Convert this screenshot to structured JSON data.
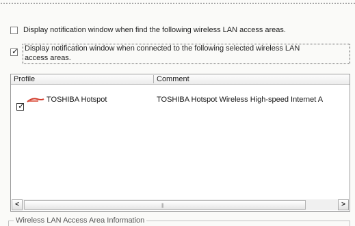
{
  "options": {
    "find_areas_label": "Display notification window when find the following wireless LAN access areas.",
    "find_areas_checked": false,
    "connected_areas_label_line1": "Display notification window when connected to the following selected wireless LAN",
    "connected_areas_label_line2": "access areas.",
    "connected_areas_checked": true
  },
  "profile_list": {
    "columns": [
      "Profile",
      "Comment"
    ],
    "rows": [
      {
        "checked": true,
        "profile": "TOSHIBA Hotspot",
        "comment": "TOSHIBA Hotspot Wireless High-speed Internet A"
      }
    ],
    "scroll_left_glyph": "<",
    "scroll_right_glyph": ">",
    "icon": "hotspot-logo-icon",
    "icon_color": "#d23a2a"
  },
  "info_group": {
    "title": "Wireless LAN Access Area Information"
  },
  "check_glyph": "✓"
}
